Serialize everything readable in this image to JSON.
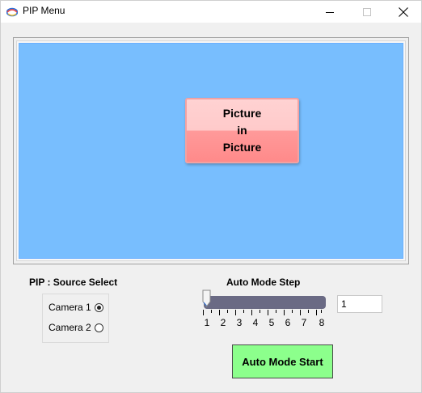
{
  "window": {
    "title": "PIP Menu"
  },
  "icons": {
    "app": "app-icon",
    "minimize": "minimize-icon",
    "maximize": "maximize-icon",
    "close": "close-icon"
  },
  "preview": {
    "lines": [
      "Picture",
      "in",
      "Picture"
    ],
    "background_color": "#78befe",
    "pip_color": "#ff9a9a"
  },
  "source_select": {
    "label": "PIP : Source Select",
    "options": [
      {
        "label": "Camera 1",
        "checked": true
      },
      {
        "label": "Camera 2",
        "checked": false
      }
    ]
  },
  "auto_mode_step": {
    "label": "Auto Mode Step",
    "min": 1,
    "max": 8,
    "value": 1,
    "tick_labels": [
      "1",
      "2",
      "3",
      "4",
      "5",
      "6",
      "7",
      "8"
    ],
    "input_value": "1"
  },
  "buttons": {
    "start_label": "Auto Mode Start",
    "start_color": "#8cff8c"
  }
}
